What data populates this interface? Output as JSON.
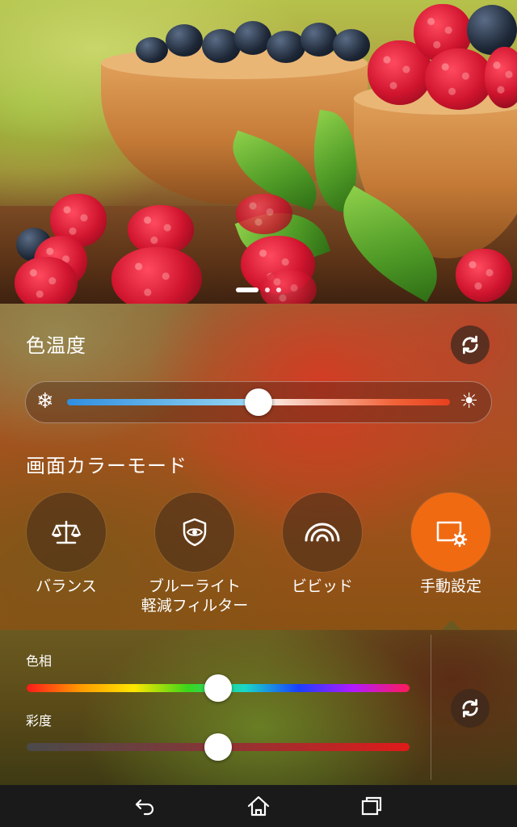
{
  "preview": {
    "page_indicator": {
      "pages": 3,
      "current": 1
    }
  },
  "color_temperature": {
    "title": "色温度",
    "reset_icon": "refresh-icon",
    "cool_icon": "snowflake-icon",
    "warm_icon": "sun-icon",
    "value_fraction": 0.5
  },
  "screen_color_mode": {
    "title": "画面カラーモード",
    "modes": [
      {
        "label": "バランス",
        "icon": "balance-scale-icon",
        "selected": false
      },
      {
        "label": "ブルーライト\n軽減フィルター",
        "icon": "eye-shield-icon",
        "selected": false
      },
      {
        "label": "ビビッド",
        "icon": "rainbow-icon",
        "selected": false
      },
      {
        "label": "手動設定",
        "icon": "screen-settings-icon",
        "selected": true
      }
    ],
    "accent_color": "#f06a12"
  },
  "manual": {
    "hue_label": "色相",
    "saturation_label": "彩度",
    "hue_fraction": 0.5,
    "saturation_fraction": 0.5,
    "reset_icon": "refresh-icon"
  },
  "navbar": {
    "back_icon": "back-icon",
    "home_icon": "home-icon",
    "recents_icon": "recents-icon"
  }
}
